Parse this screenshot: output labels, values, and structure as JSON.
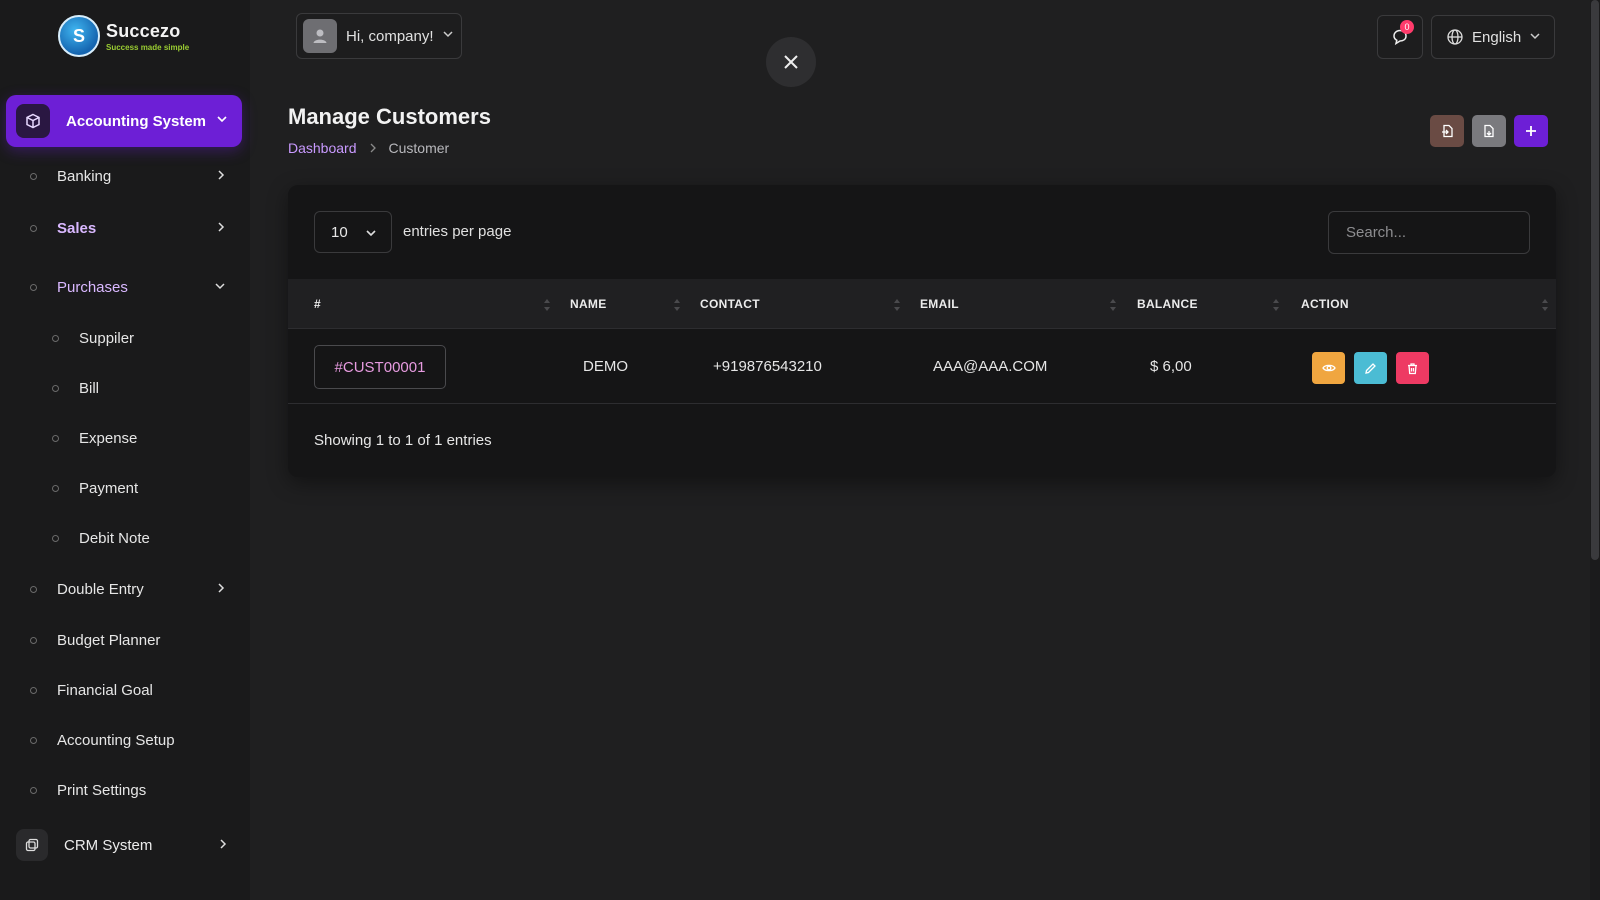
{
  "brand": {
    "name": "Succezo",
    "tagline": "Success made simple",
    "logo_letter": "S"
  },
  "sidebar": {
    "active_section": "Accounting System",
    "items": [
      {
        "label": "Banking"
      },
      {
        "label": "Sales"
      },
      {
        "label": "Purchases"
      },
      {
        "label": "Suppiler"
      },
      {
        "label": "Bill"
      },
      {
        "label": "Expense"
      },
      {
        "label": "Payment"
      },
      {
        "label": "Debit Note"
      },
      {
        "label": "Double Entry"
      },
      {
        "label": "Budget Planner"
      },
      {
        "label": "Financial Goal"
      },
      {
        "label": "Accounting Setup"
      },
      {
        "label": "Print Settings"
      }
    ],
    "crm": "CRM System"
  },
  "topbar": {
    "greeting": "Hi, company!",
    "notifications": "0",
    "language": "English"
  },
  "page": {
    "title": "Manage Customers",
    "breadcrumb": {
      "root": "Dashboard",
      "current": "Customer"
    }
  },
  "table": {
    "entries_value": "10",
    "entries_label": "entries per page",
    "search_placeholder": "Search...",
    "columns": [
      "#",
      "NAME",
      "CONTACT",
      "EMAIL",
      "BALANCE",
      "ACTION"
    ],
    "rows": [
      {
        "id": "#CUST00001",
        "name": "DEMO",
        "contact": "+919876543210",
        "email": "AAA@AAA.COM",
        "balance": "$ 6,00"
      }
    ],
    "footer": "Showing 1 to 1 of 1 entries"
  },
  "colors": {
    "accent": "#6d1fd6",
    "view": "#f0a640",
    "edit": "#4bbcd4",
    "delete": "#ee3a63"
  }
}
